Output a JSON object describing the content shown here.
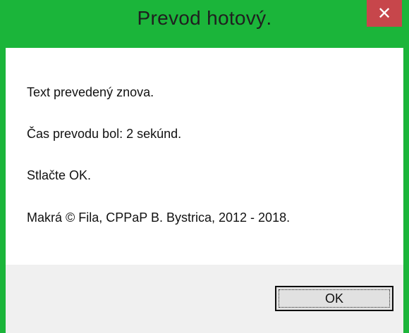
{
  "window": {
    "title": "Prevod hotový.",
    "close_glyph": "✕",
    "accent_color": "#1bb53a",
    "close_color": "#c7464b"
  },
  "messages": [
    "Text prevedený znova.",
    "Čas prevodu bol: 2 sekúnd.",
    "Stlačte OK.",
    "Makrá © Fila, CPPaP B. Bystrica, 2012 - 2018."
  ],
  "buttons": {
    "ok_label": "OK"
  }
}
